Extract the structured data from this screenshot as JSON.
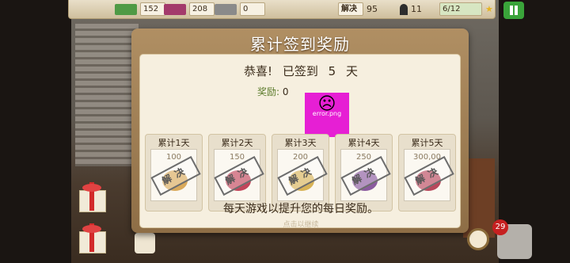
{
  "topbar": {
    "money": "152",
    "candy": "208",
    "papers": "0",
    "fix_label": "解决",
    "fix_value": "95",
    "people": "11",
    "progress": "6/12"
  },
  "modal": {
    "title": "累计签到奖励",
    "congrats_prefix": "恭喜!",
    "congrats_middle": "已签到",
    "congrats_days": "5",
    "congrats_suffix": "天",
    "reward_label": "奖励:",
    "reward_value": "0",
    "error_image_text": "error.png",
    "cards": [
      {
        "day": "累计1天",
        "amount": "100",
        "stamp": "解决"
      },
      {
        "day": "累计2天",
        "amount": "150",
        "stamp": "解决"
      },
      {
        "day": "累计3天",
        "amount": "200",
        "stamp": "解决"
      },
      {
        "day": "累计4天",
        "amount": "250",
        "stamp": "解决"
      },
      {
        "day": "累计5天",
        "amount": "300,00",
        "stamp": "解决"
      }
    ],
    "footer": "每天游戏以提升您的每日奖励。",
    "close_hint": "点击以继续"
  },
  "hud": {
    "phone_badge": "29"
  },
  "colors": {
    "modal_frame": "#a07e53",
    "modal_inner": "#f6efdf",
    "pause_button": "#3aa43a",
    "error_placeholder": "#e61fd4"
  }
}
